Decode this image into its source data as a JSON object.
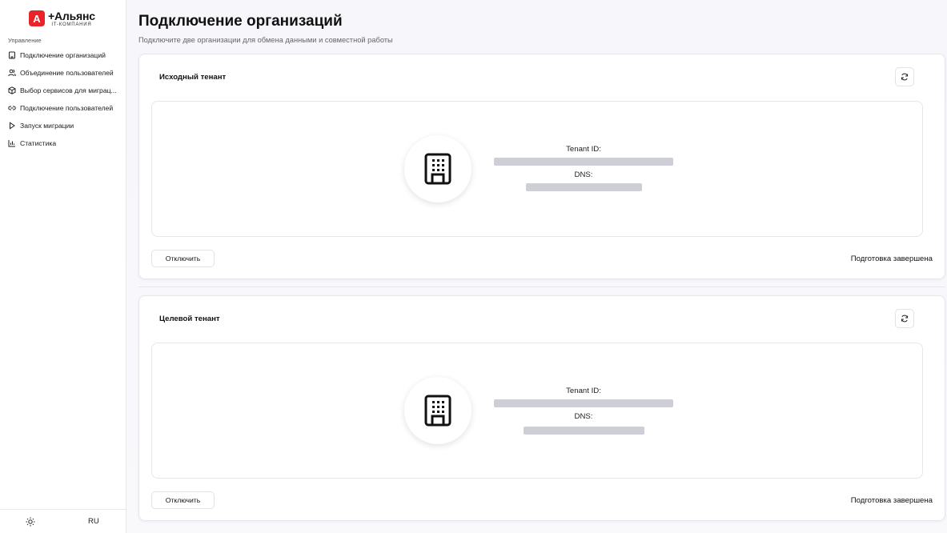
{
  "brand": {
    "mark": "А",
    "name": "+Альянс",
    "subtitle": "IT-КОМПАНИЯ",
    "accent_color": "#e8242b"
  },
  "sidebar": {
    "section_label": "Управление",
    "items": [
      {
        "label": "Подключение организаций",
        "icon": "building-icon"
      },
      {
        "label": "Объединение пользователей",
        "icon": "users-icon"
      },
      {
        "label": "Выбор сервисов для миграц...",
        "icon": "box-icon"
      },
      {
        "label": "Подключение пользователей",
        "icon": "link-icon"
      },
      {
        "label": "Запуск миграции",
        "icon": "play-icon"
      },
      {
        "label": "Статистика",
        "icon": "chart-icon"
      }
    ],
    "footer": {
      "theme_icon": "sun-icon",
      "language": "RU"
    }
  },
  "main": {
    "title": "Подключение организаций",
    "subtitle": "Подключите две организации для обмена данными и совместной работы",
    "tenants": [
      {
        "title": "Исходный тенант",
        "tenant_id_label": "Tenant ID:",
        "dns_label": "DNS:",
        "disconnect_label": "Отключить",
        "status": "Подготовка завершена"
      },
      {
        "title": "Целевой тенант",
        "tenant_id_label": "Tenant ID:",
        "dns_label": "DNS:",
        "disconnect_label": "Отключить",
        "status": "Подготовка завершена"
      }
    ]
  }
}
